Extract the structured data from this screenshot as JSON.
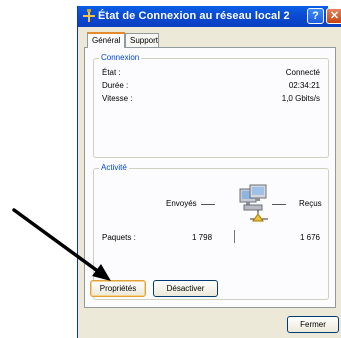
{
  "window": {
    "title": "État de Connexion au réseau local 2",
    "help_label": "?",
    "close_label": "✕",
    "title_icon": "network-connection-icon"
  },
  "tabs": [
    {
      "label": "Général",
      "active": true
    },
    {
      "label": "Support",
      "active": false
    }
  ],
  "connection": {
    "legend": "Connexion",
    "rows": [
      {
        "label": "État :",
        "value": "Connecté"
      },
      {
        "label": "Durée :",
        "value": "02:34:21"
      },
      {
        "label": "Vitesse :",
        "value": "1,0 Gbits/s"
      }
    ]
  },
  "activity": {
    "legend": "Activité",
    "sent_label": "Envoyés",
    "received_label": "Reçus",
    "packets_label": "Paquets :",
    "packets_sent": "1 798",
    "packets_received": "1 676",
    "icon": "network-computers-icon"
  },
  "buttons": {
    "properties": "Propriétés",
    "disable": "Désactiver",
    "close": "Fermer"
  },
  "annotation": {
    "icon": "black-arrow-pointer"
  },
  "colors": {
    "title_bar": "#0b49d1",
    "dialog_bg": "#ece9d8",
    "legend_text": "#0046d5",
    "close_button": "#c8410f"
  }
}
